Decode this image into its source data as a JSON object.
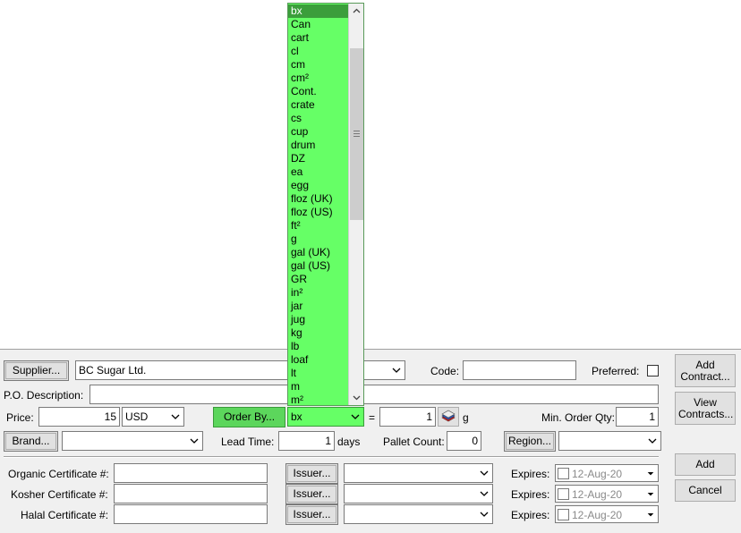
{
  "supplier": {
    "button": "Supplier...",
    "value": "BC Sugar Ltd."
  },
  "code": {
    "label": "Code:",
    "value": ""
  },
  "preferred": {
    "label": "Preferred:",
    "checked": false
  },
  "po_description": {
    "label": "P.O. Description:",
    "value": ""
  },
  "price": {
    "label": "Price:",
    "value": "15",
    "currency": "USD"
  },
  "order_by": {
    "button": "Order By...",
    "unit": "bx",
    "equals": "=",
    "qty": "1",
    "target_unit": "g"
  },
  "min_order_qty": {
    "label": "Min. Order Qty:",
    "value": "1"
  },
  "brand": {
    "button": "Brand...",
    "value": ""
  },
  "lead_time": {
    "label": "Lead Time:",
    "value": "1",
    "unit": "days"
  },
  "pallet_count": {
    "label": "Pallet Count:",
    "value": "0"
  },
  "region": {
    "button": "Region...",
    "value": ""
  },
  "certificates": [
    {
      "label": "Organic Certificate #:",
      "value": "",
      "issuer_button": "Issuer...",
      "issuer": "",
      "expires_label": "Expires:",
      "expires": "12-Aug-20"
    },
    {
      "label": "Kosher Certificate #:",
      "value": "",
      "issuer_button": "Issuer...",
      "issuer": "",
      "expires_label": "Expires:",
      "expires": "12-Aug-20"
    },
    {
      "label": "Halal Certificate #:",
      "value": "",
      "issuer_button": "Issuer...",
      "issuer": "",
      "expires_label": "Expires:",
      "expires": "12-Aug-20"
    }
  ],
  "side_buttons": {
    "add_contract": "Add Contract...",
    "view_contracts": "View Contracts...",
    "add": "Add",
    "cancel": "Cancel"
  },
  "dropdown": {
    "items": [
      "bx",
      "Can",
      "cart",
      "cl",
      "cm",
      "cm²",
      "Cont.",
      "crate",
      "cs",
      "cup",
      "drum",
      "DZ",
      "ea",
      "egg",
      "floz (UK)",
      "floz (US)",
      "ft²",
      "g",
      "gal (UK)",
      "gal (US)",
      "GR",
      "in²",
      "jar",
      "jug",
      "kg",
      "lb",
      "loaf",
      "lt",
      "m",
      "m²"
    ],
    "selected": "bx",
    "scroll_fraction": 0.15
  },
  "colors": {
    "accent_green": "#66ff66",
    "selected_green": "#3b9e3b",
    "order_by_green": "#5cd65c"
  }
}
